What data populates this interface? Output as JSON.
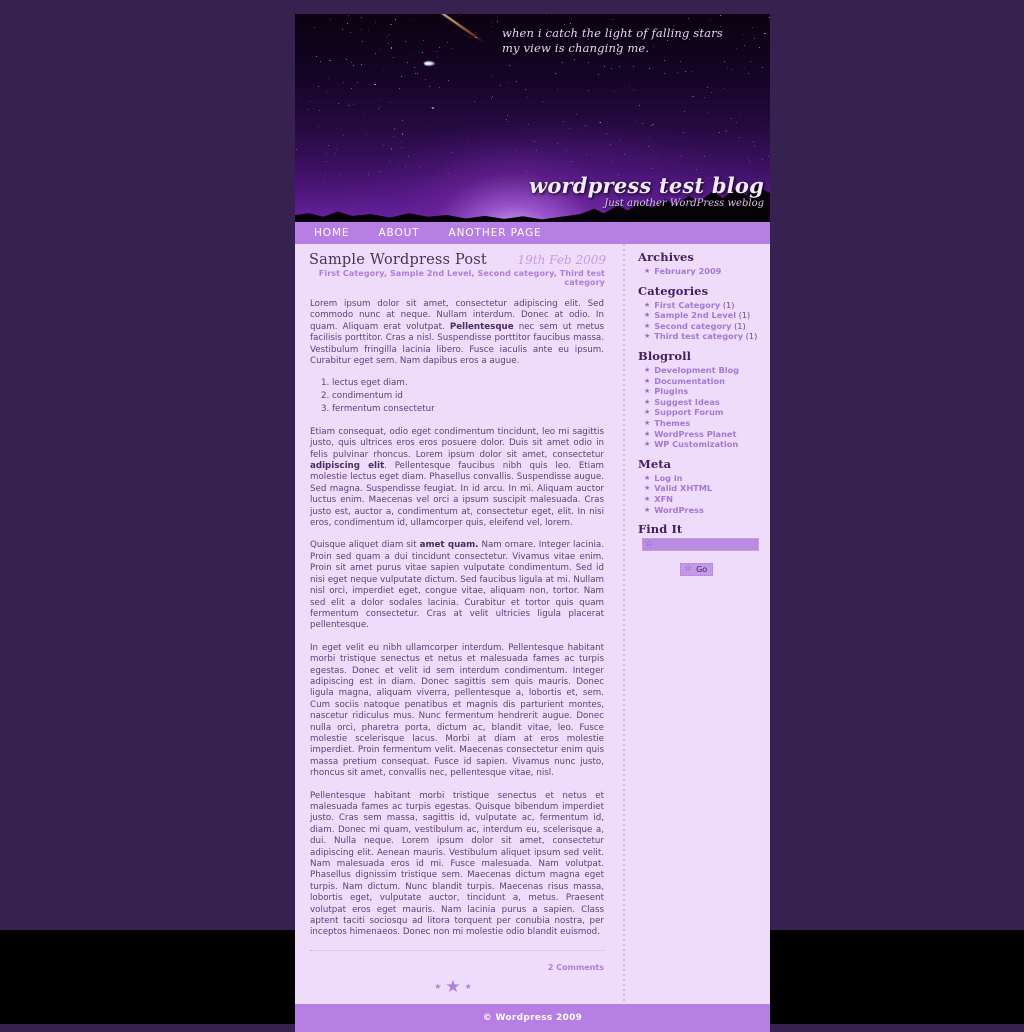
{
  "theme": {
    "page_bg": "#372150",
    "content_bg": "#eedcfa",
    "accent": "#b77ee4",
    "heading": "#46205e",
    "link": "#a579d4"
  },
  "banner": {
    "quote_line1": "when i catch the light of falling stars",
    "quote_line2": "my view is changing me.",
    "blog_title": "wordpress test blog",
    "tagline": "Just another WordPress weblog"
  },
  "nav": {
    "items": [
      {
        "label": "HOME"
      },
      {
        "label": "ABOUT"
      },
      {
        "label": "ANOTHER PAGE"
      }
    ]
  },
  "post": {
    "title": "Sample Wordpress Post",
    "date": "19th Feb 2009",
    "categories": "First Category, Sample 2nd Level, Second category, Third test category",
    "paragraphs": [
      "Lorem ipsum dolor sit amet, consectetur adipiscing elit. Sed commodo nunc at neque. Nullam interdum. Donec at odio. In quam. Aliquam erat volutpat. Pellentesque nec sem ut metus facilisis porttitor. Cras a nisl. Suspendisse porttitor faucibus massa. Vestibulum fringilla lacinia libero. Fusce iaculis ante eu ipsum. Curabitur eget sem. Nam dapibus eros a augue."
    ],
    "p1_bold": "Pellentesque",
    "p1_before": "Lorem ipsum dolor sit amet, consectetur adipiscing elit. Sed commodo nunc at neque. Nullam interdum. Donec at odio. In quam. Aliquam erat volutpat. ",
    "p1_after": " nec sem ut metus facilisis porttitor. Cras a nisl. Suspendisse porttitor faucibus massa. Vestibulum fringilla lacinia libero. Fusce iaculis ante eu ipsum. Curabitur eget sem. Nam dapibus eros a augue.",
    "list_items": [
      "lectus eget diam.",
      "condimentum id",
      "fermentum consectetur"
    ],
    "p2_before": "Etiam consequat, odio eget condimentum tincidunt, leo mi sagittis justo, quis ultrices eros eros posuere dolor. Duis sit amet odio in felis pulvinar rhoncus. Lorem ipsum dolor sit amet, consectetur ",
    "p2_bold": "adipiscing elit",
    "p2_after": ". Pellentesque faucibus nibh quis leo. Etiam molestie lectus eget diam. Phasellus convallis. Suspendisse augue. Sed magna. Suspendisse feugiat. In id arcu. In mi. Aliquam auctor luctus enim. Maecenas vel orci a ipsum suscipit malesuada. Cras justo est, auctor a, condimentum at, consectetur eget, elit. In nisi eros, condimentum id, ullamcorper quis, eleifend vel, lorem.",
    "p3_before": "Quisque aliquet diam sit ",
    "p3_bold": "amet quam.",
    "p3_after": " Nam ornare. Integer lacinia. Proin sed quam a dui tincidunt consectetur. Vivamus vitae enim. Proin sit amet purus vitae sapien vulputate condimentum. Sed id nisi eget neque vulputate dictum. Sed faucibus ligula at mi. Nullam nisl orci, imperdiet eget, congue vitae, aliquam non, tortor. Nam sed elit a dolor sodales lacinia. Curabitur et tortor quis quam fermentum consectetur. Cras at velit ultricies ligula placerat pellentesque.",
    "p4": "In eget velit eu nibh ullamcorper interdum. Pellentesque habitant morbi tristique senectus et netus et malesuada fames ac turpis egestas. Donec et velit id sem interdum condimentum. Integer adipiscing est in diam. Donec sagittis sem quis mauris. Donec ligula magna, aliquam viverra, pellentesque a, lobortis et, sem. Cum sociis natoque penatibus et magnis dis parturient montes, nascetur ridiculus mus. Nunc fermentum hendrerit augue. Donec nulla orci, pharetra porta, dictum ac, blandit vitae, leo. Fusce molestie scelerisque lacus. Morbi at diam at eros molestie imperdiet. Proin fermentum velit. Maecenas consectetur enim quis massa pretium consequat. Fusce id sapien. Vivamus nunc justo, rhoncus sit amet, convallis nec, pellentesque vitae, nisl.",
    "p5": "Pellentesque habitant morbi tristique senectus et netus et malesuada fames ac turpis egestas. Quisque bibendum imperdiet justo. Cras sem massa, sagittis id, vulputate ac, fermentum id, diam. Donec mi quam, vestibulum ac, interdum eu, scelerisque a, dui. Nulla neque. Lorem ipsum dolor sit amet, consectetur adipiscing elit. Aenean mauris. Vestibulum aliquet ipsum sed velit. Nam malesuada eros id mi. Fusce malesuada. Nam volutpat. Phasellus dignissim tristique sem. Maecenas dictum magna eget turpis. Nam dictum. Nunc blandit turpis. Maecenas risus massa, lobortis eget, vulputate auctor, tincidunt a, metus. Praesent volutpat eros eget mauris. Nam lacinia purus a sapien. Class aptent taciti sociosqu ad litora torquent per conubia nostra, per inceptos himenaeos. Donec non mi molestie odio blandit euismod.",
    "comments": "2 Comments"
  },
  "sidebar": {
    "archives": {
      "title": "Archives",
      "items": [
        {
          "label": "February 2009"
        }
      ]
    },
    "categories": {
      "title": "Categories",
      "items": [
        {
          "label": "First Category",
          "count": "(1)"
        },
        {
          "label": "Sample 2nd Level",
          "count": "(1)"
        },
        {
          "label": "Second category",
          "count": "(1)"
        },
        {
          "label": "Third test category",
          "count": "(1)"
        }
      ]
    },
    "blogroll": {
      "title": "Blogroll",
      "items": [
        {
          "label": "Development Blog"
        },
        {
          "label": "Documentation"
        },
        {
          "label": "Plugins"
        },
        {
          "label": "Suggest Ideas"
        },
        {
          "label": "Support Forum"
        },
        {
          "label": "Themes"
        },
        {
          "label": "WordPress Planet"
        },
        {
          "label": "WP Customization"
        }
      ]
    },
    "meta": {
      "title": "Meta",
      "items": [
        {
          "label": "Log in"
        },
        {
          "label": "Valid XHTML"
        },
        {
          "label": "XFN"
        },
        {
          "label": "WordPress"
        }
      ]
    },
    "search": {
      "title": "Find It",
      "value": "",
      "placeholder": "",
      "button_label": "Go"
    }
  },
  "footer": {
    "copyright": "© Wordpress 2009"
  }
}
